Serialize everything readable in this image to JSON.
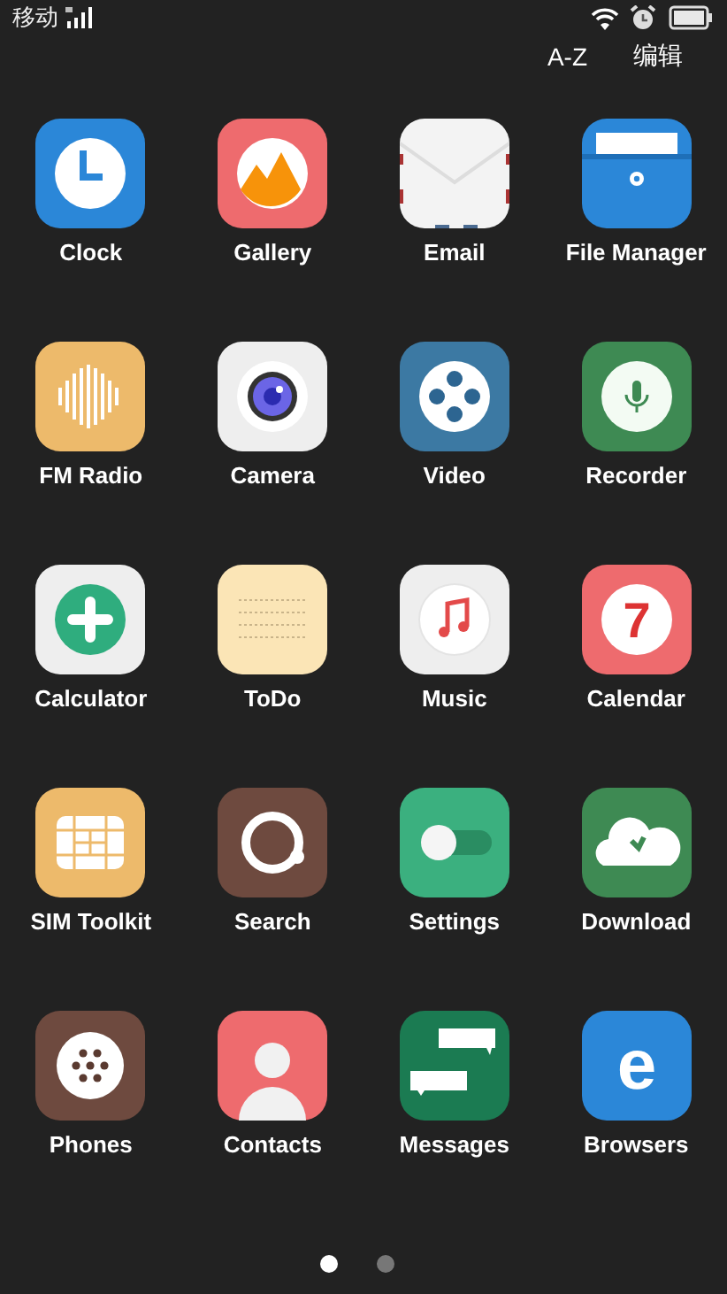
{
  "status_bar": {
    "carrier": "移动"
  },
  "header": {
    "actions": [
      "A-Z",
      "编辑"
    ]
  },
  "apps": [
    {
      "label": "Clock",
      "kind": "clock"
    },
    {
      "label": "Gallery",
      "kind": "gallery"
    },
    {
      "label": "Email",
      "kind": "email"
    },
    {
      "label": "File Manager",
      "kind": "folder"
    },
    {
      "label": "FM Radio",
      "kind": "radio"
    },
    {
      "label": "Camera",
      "kind": "camera"
    },
    {
      "label": "Video",
      "kind": "video"
    },
    {
      "label": "Recorder",
      "kind": "recorder"
    },
    {
      "label": "Calculator",
      "kind": "calculator"
    },
    {
      "label": "ToDo",
      "kind": "todo"
    },
    {
      "label": "Music",
      "kind": "music"
    },
    {
      "label": "Calendar",
      "kind": "calendar",
      "glyph": "7"
    },
    {
      "label": "SIM Toolkit",
      "kind": "sim"
    },
    {
      "label": "Search",
      "kind": "search"
    },
    {
      "label": "Settings",
      "kind": "settings"
    },
    {
      "label": "Download",
      "kind": "download"
    },
    {
      "label": "Phones",
      "kind": "phone"
    },
    {
      "label": "Contacts",
      "kind": "contact"
    },
    {
      "label": "Messages",
      "kind": "messages"
    },
    {
      "label": "Browsers",
      "kind": "browser",
      "glyph": "e"
    }
  ],
  "pages": [
    {
      "selected": true
    },
    {
      "selected": false
    }
  ]
}
